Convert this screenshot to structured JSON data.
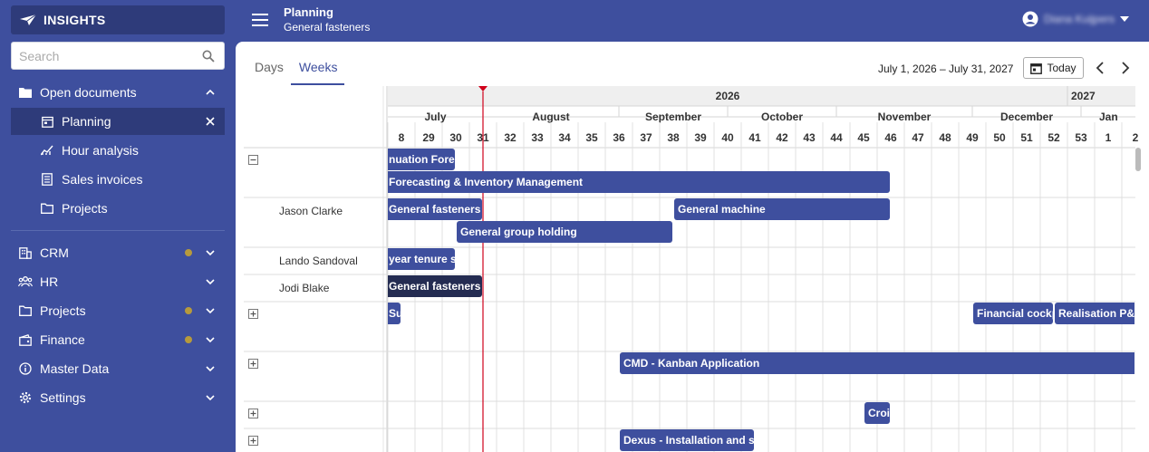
{
  "brand": {
    "name": "INSIGHTS"
  },
  "search": {
    "placeholder": "Search"
  },
  "sidebar": {
    "open_documents": "Open documents",
    "sub_items": [
      {
        "label": "Planning",
        "icon": "calendar-icon",
        "active": true
      },
      {
        "label": "Hour analysis",
        "icon": "chart-line-icon"
      },
      {
        "label": "Sales invoices",
        "icon": "invoice-icon"
      },
      {
        "label": "Projects",
        "icon": "folder-icon"
      }
    ],
    "sections": [
      {
        "label": "CRM",
        "icon": "building-icon",
        "dot": true
      },
      {
        "label": "HR",
        "icon": "people-icon",
        "dot": false
      },
      {
        "label": "Projects",
        "icon": "folder-icon",
        "dot": true
      },
      {
        "label": "Finance",
        "icon": "finance-icon",
        "dot": true
      },
      {
        "label": "Master Data",
        "icon": "info-icon",
        "dot": false
      },
      {
        "label": "Settings",
        "icon": "gear-icon",
        "dot": false
      }
    ]
  },
  "header": {
    "title": "Planning",
    "subtitle": "General fasteners",
    "user_name": "Diana Kuijpers"
  },
  "toolbar": {
    "tabs": [
      "Days",
      "Weeks"
    ],
    "active_tab": "Weeks",
    "date_range": "July 1, 2026 – July 31, 2027",
    "today_label": "Today"
  },
  "gantt": {
    "years": [
      {
        "label": "2026",
        "from": 0,
        "to": 25
      },
      {
        "label": "2027",
        "from": 25,
        "to": 28
      }
    ],
    "months": [
      {
        "label": "July",
        "from": 0,
        "to": 3.5
      },
      {
        "label": "August",
        "from": 3.5,
        "to": 8.5
      },
      {
        "label": "September",
        "from": 8.5,
        "to": 12.5
      },
      {
        "label": "October",
        "from": 12.5,
        "to": 16.5
      },
      {
        "label": "November",
        "from": 16.5,
        "to": 21.5
      },
      {
        "label": "December",
        "from": 21.5,
        "to": 25.5
      },
      {
        "label": "Jan",
        "from": 25.5,
        "to": 28
      }
    ],
    "weeks": [
      "8",
      "29",
      "30",
      "31",
      "32",
      "33",
      "34",
      "35",
      "36",
      "37",
      "38",
      "39",
      "40",
      "41",
      "42",
      "43",
      "44",
      "45",
      "46",
      "47",
      "48",
      "49",
      "50",
      "51",
      "52",
      "53",
      "1",
      "2"
    ],
    "today_week": 3.5,
    "rows": [
      {
        "resource": "",
        "expander": "−",
        "lines": 2
      },
      {
        "resource": "Jason Clarke",
        "lines": 2
      },
      {
        "resource": "Lando Sandoval",
        "lines": 1
      },
      {
        "resource": "Jodi Blake",
        "lines": 1
      },
      {
        "resource": "",
        "expander": "+",
        "lines": 2
      },
      {
        "resource": "",
        "expander": "+",
        "lines": 2
      },
      {
        "resource": "",
        "expander": "+",
        "lines": 1
      },
      {
        "resource": "",
        "expander": "+",
        "lines": 1
      }
    ],
    "tasks": [
      {
        "label": "nuation Forec",
        "row": 0,
        "line": 0,
        "start": 0,
        "end": 2.5,
        "cut_left": true
      },
      {
        "label": "Forecasting & Inventory Management",
        "row": 0,
        "line": 1,
        "start": 0,
        "end": 18.5,
        "cut_left": true
      },
      {
        "label": "General fasteners",
        "row": 1,
        "line": 0,
        "start": 0,
        "end": 3.5,
        "cut_left": true
      },
      {
        "label": "General machine",
        "row": 1,
        "line": 0,
        "start": 10.5,
        "end": 18.5
      },
      {
        "label": "General group holding",
        "row": 1,
        "line": 1,
        "start": 2.5,
        "end": 10.5
      },
      {
        "label": "year tenure se",
        "row": 2,
        "line": 0,
        "start": 0,
        "end": 2.5,
        "cut_left": true
      },
      {
        "label": "General fasteners",
        "row": 3,
        "line": 0,
        "start": 0,
        "end": 3.5,
        "cut_left": true,
        "dark": true
      },
      {
        "label": "Su",
        "row": 4,
        "line": 0,
        "start": 0,
        "end": 0.5,
        "cut_left": true
      },
      {
        "label": "Financial cockp",
        "row": 4,
        "line": 0,
        "start": 21.5,
        "end": 24.5
      },
      {
        "label": "Realisation P&l",
        "row": 4,
        "line": 0,
        "start": 24.5,
        "end": 27.5,
        "cut_right": true
      },
      {
        "label": "CMD - Kanban Application",
        "row": 5,
        "line": 0,
        "start": 8.5,
        "end": 28,
        "cut_right": true
      },
      {
        "label": "Croi",
        "row": 6,
        "line": 0,
        "start": 17.5,
        "end": 18.5
      },
      {
        "label": "Dexus - Installation and su",
        "row": 7,
        "line": 0,
        "start": 8.5,
        "end": 13.5
      }
    ]
  },
  "colors": {
    "primary": "#3e4f9e",
    "primary_dark": "#2e3b7a",
    "selected_task": "#242c52",
    "today_line": "#d0021b",
    "notification_dot": "#b79a3c"
  }
}
